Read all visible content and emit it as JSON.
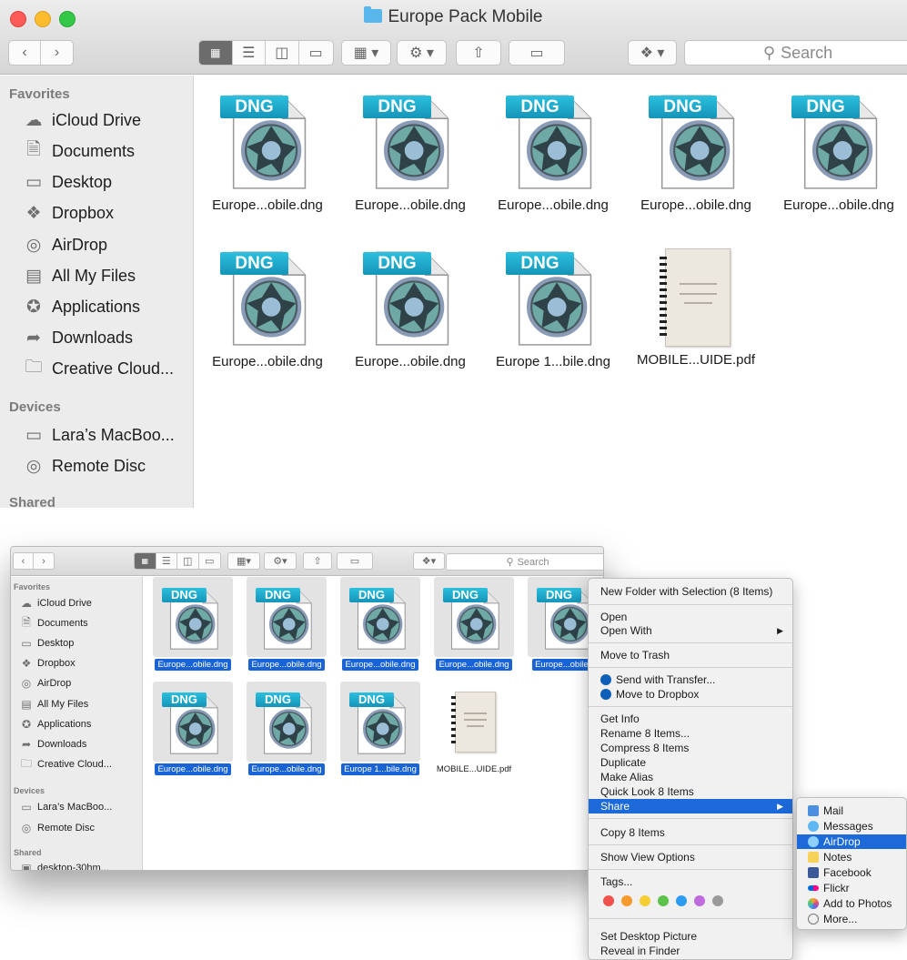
{
  "top_window": {
    "title": "Europe Pack Mobile",
    "search_placeholder": "Search",
    "sidebar": {
      "favorites_header": "Favorites",
      "favorites": [
        {
          "label": "iCloud Drive",
          "icon": "cloud-icon"
        },
        {
          "label": "Documents",
          "icon": "documents-icon"
        },
        {
          "label": "Desktop",
          "icon": "desktop-icon"
        },
        {
          "label": "Dropbox",
          "icon": "dropbox-icon"
        },
        {
          "label": "AirDrop",
          "icon": "airdrop-icon"
        },
        {
          "label": "All My Files",
          "icon": "all-files-icon"
        },
        {
          "label": "Applications",
          "icon": "applications-icon"
        },
        {
          "label": "Downloads",
          "icon": "downloads-icon"
        },
        {
          "label": "Creative Cloud...",
          "icon": "folder-icon"
        }
      ],
      "devices_header": "Devices",
      "devices": [
        {
          "label": "Lara’s MacBoo...",
          "icon": "laptop-icon"
        },
        {
          "label": "Remote Disc",
          "icon": "disc-icon"
        }
      ],
      "shared_header": "Shared"
    },
    "files": [
      {
        "name": "Europe...obile.dng",
        "type": "dng"
      },
      {
        "name": "Europe...obile.dng",
        "type": "dng"
      },
      {
        "name": "Europe...obile.dng",
        "type": "dng"
      },
      {
        "name": "Europe...obile.dng",
        "type": "dng"
      },
      {
        "name": "Europe...obile.dng",
        "type": "dng"
      },
      {
        "name": "Europe...obile.dng",
        "type": "dng"
      },
      {
        "name": "Europe...obile.dng",
        "type": "dng"
      },
      {
        "name": "Europe 1...bile.dng",
        "type": "dng"
      },
      {
        "name": "MOBILE...UIDE.pdf",
        "type": "pdf"
      }
    ]
  },
  "bottom_window": {
    "search_placeholder": "Search",
    "sidebar": {
      "favorites_header": "Favorites",
      "favorites": [
        {
          "label": "iCloud Drive",
          "icon": "cloud-icon"
        },
        {
          "label": "Documents",
          "icon": "documents-icon"
        },
        {
          "label": "Desktop",
          "icon": "desktop-icon"
        },
        {
          "label": "Dropbox",
          "icon": "dropbox-icon"
        },
        {
          "label": "AirDrop",
          "icon": "airdrop-icon"
        },
        {
          "label": "All My Files",
          "icon": "all-files-icon"
        },
        {
          "label": "Applications",
          "icon": "applications-icon"
        },
        {
          "label": "Downloads",
          "icon": "downloads-icon"
        },
        {
          "label": "Creative Cloud...",
          "icon": "folder-icon"
        }
      ],
      "devices_header": "Devices",
      "devices": [
        {
          "label": "Lara’s MacBoo...",
          "icon": "laptop-icon"
        },
        {
          "label": "Remote Disc",
          "icon": "disc-icon"
        }
      ],
      "shared_header": "Shared",
      "shared": [
        {
          "label": "desktop-30hm...",
          "icon": "monitor-icon"
        }
      ]
    },
    "files": [
      {
        "name": "Europe...obile.dng",
        "type": "dng",
        "selected": true
      },
      {
        "name": "Europe...obile.dng",
        "type": "dng",
        "selected": true
      },
      {
        "name": "Europe...obile.dng",
        "type": "dng",
        "selected": true
      },
      {
        "name": "Europe...obile.dng",
        "type": "dng",
        "selected": true
      },
      {
        "name": "Europe...obile.dn",
        "type": "dng",
        "selected": true
      },
      {
        "name": "Europe...obile.dng",
        "type": "dng",
        "selected": true
      },
      {
        "name": "Europe...obile.dng",
        "type": "dng",
        "selected": true
      },
      {
        "name": "Europe 1...bile.dng",
        "type": "dng",
        "selected": true
      },
      {
        "name": "MOBILE...UIDE.pdf",
        "type": "pdf",
        "selected": false
      }
    ]
  },
  "dng_badge": "DNG",
  "context_menu": {
    "new_folder": "New Folder with Selection (8 Items)",
    "open": "Open",
    "open_with": "Open With",
    "move_to_trash": "Move to Trash",
    "send_with_transfer": "Send with Transfer...",
    "move_to_dropbox": "Move to Dropbox",
    "get_info": "Get Info",
    "rename": "Rename 8 Items...",
    "compress": "Compress 8 Items",
    "duplicate": "Duplicate",
    "make_alias": "Make Alias",
    "quick_look": "Quick Look 8 Items",
    "share": "Share",
    "copy": "Copy 8 Items",
    "show_view_options": "Show View Options",
    "tags": "Tags...",
    "tag_colors": [
      "#f0514b",
      "#f69a2d",
      "#f5ce33",
      "#5bc34a",
      "#2d9bf0",
      "#bf6bde",
      "#9a9a9a"
    ],
    "set_desktop_picture": "Set Desktop Picture",
    "reveal_in_finder": "Reveal in Finder"
  },
  "share_submenu": {
    "items": [
      {
        "label": "Mail",
        "icon": "mail-icon"
      },
      {
        "label": "Messages",
        "icon": "messages-icon"
      },
      {
        "label": "AirDrop",
        "icon": "airdrop-icon",
        "highlighted": true
      },
      {
        "label": "Notes",
        "icon": "notes-icon"
      },
      {
        "label": "Facebook",
        "icon": "facebook-icon"
      },
      {
        "label": "Flickr",
        "icon": "flickr-icon"
      },
      {
        "label": "Add to Photos",
        "icon": "photos-icon"
      },
      {
        "label": "More...",
        "icon": "more-icon"
      }
    ]
  },
  "colors": {
    "selection_blue": "#1863d6",
    "menu_highlight": "#1c6ad9",
    "dng_teal": "#1aa6c9",
    "sidebar_bg": "#ececec"
  }
}
